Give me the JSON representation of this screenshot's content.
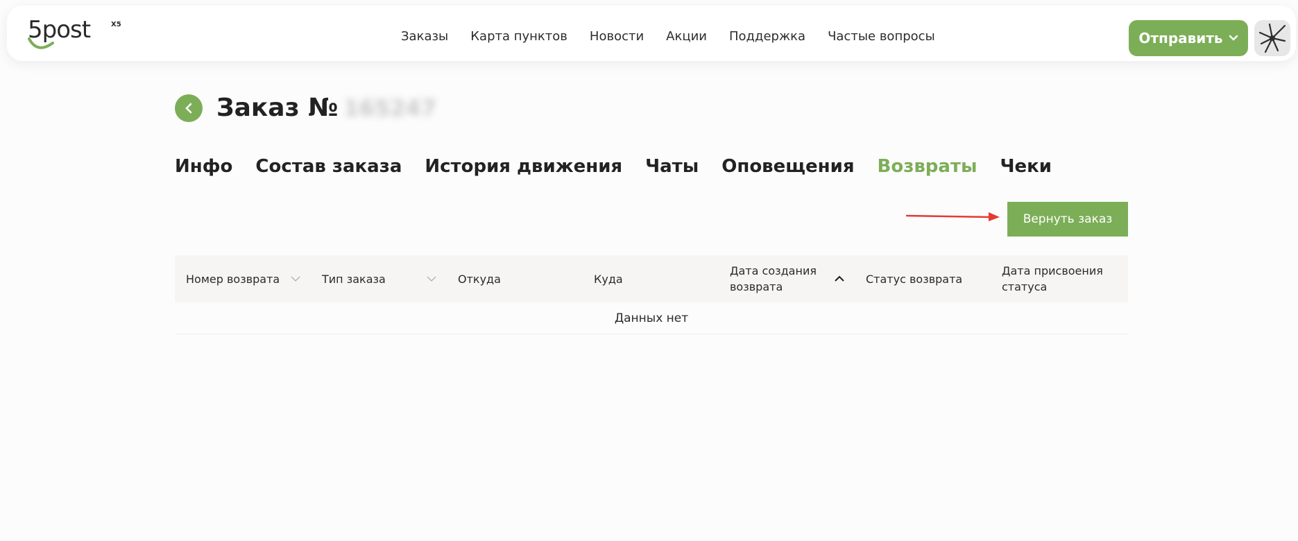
{
  "header": {
    "logo": "5post",
    "logo_badge": "X5",
    "nav": [
      "Заказы",
      "Карта пунктов",
      "Новости",
      "Акции",
      "Поддержка",
      "Частые вопросы"
    ],
    "send_label": "Отправить"
  },
  "page": {
    "title": "Заказ №",
    "order_number": "165247",
    "tabs": [
      "Инфо",
      "Состав заказа",
      "История движения",
      "Чаты",
      "Оповещения",
      "Возвраты",
      "Чеки"
    ],
    "active_tab": "Возвраты",
    "return_button": "Вернуть заказ"
  },
  "table": {
    "columns": [
      "Номер возврата",
      "Тип заказа",
      "Откуда",
      "Куда",
      "Дата создания возврата",
      "Статус возврата",
      "Дата присвоения статуса"
    ],
    "empty_text": "Данных нет"
  },
  "colors": {
    "accent": "#7cae57",
    "arrow": "#e53935"
  }
}
